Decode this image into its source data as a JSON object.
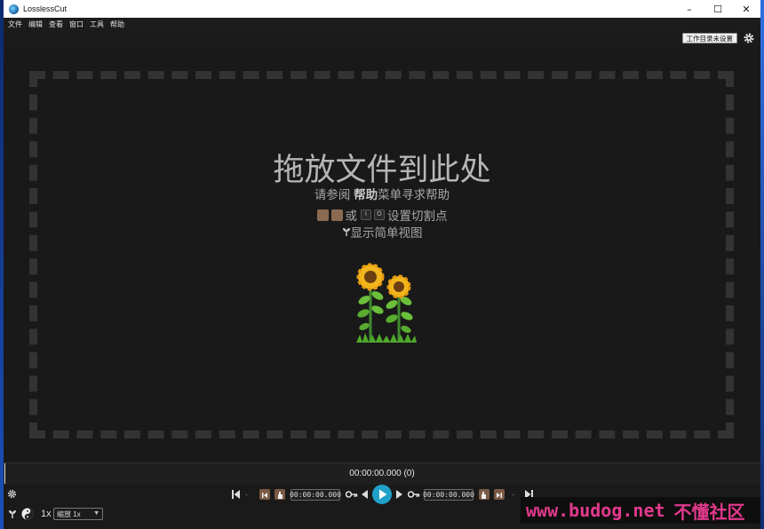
{
  "window": {
    "title": "LosslessCut"
  },
  "menu": {
    "items": [
      "文件",
      "编辑",
      "查看",
      "窗口",
      "工具",
      "帮助"
    ]
  },
  "topbar": {
    "workdir_label": "工作目录未设置"
  },
  "dropzone": {
    "title": "拖放文件到此处",
    "help_prefix": "请参阅",
    "help_bold": "帮助",
    "help_suffix": "菜单寻求帮助",
    "cut_or": "或",
    "cut_key_i": "I",
    "cut_key_o": "O",
    "cut_suffix": "设置切割点",
    "simple_view": "显示简单视图"
  },
  "timeline": {
    "time_label": "00:00:00.000 (0)"
  },
  "controls": {
    "cut_start_time": "00:00:00.000",
    "cut_end_time": "00:00:00.000",
    "speed": "1x",
    "zoom": "缩放 1x"
  },
  "watermark": {
    "url": "www.budog.net",
    "name": "不懂社区"
  },
  "colors": {
    "accent": "#21a1c9",
    "background": "#191919",
    "cut_button": "#7a5a44"
  }
}
